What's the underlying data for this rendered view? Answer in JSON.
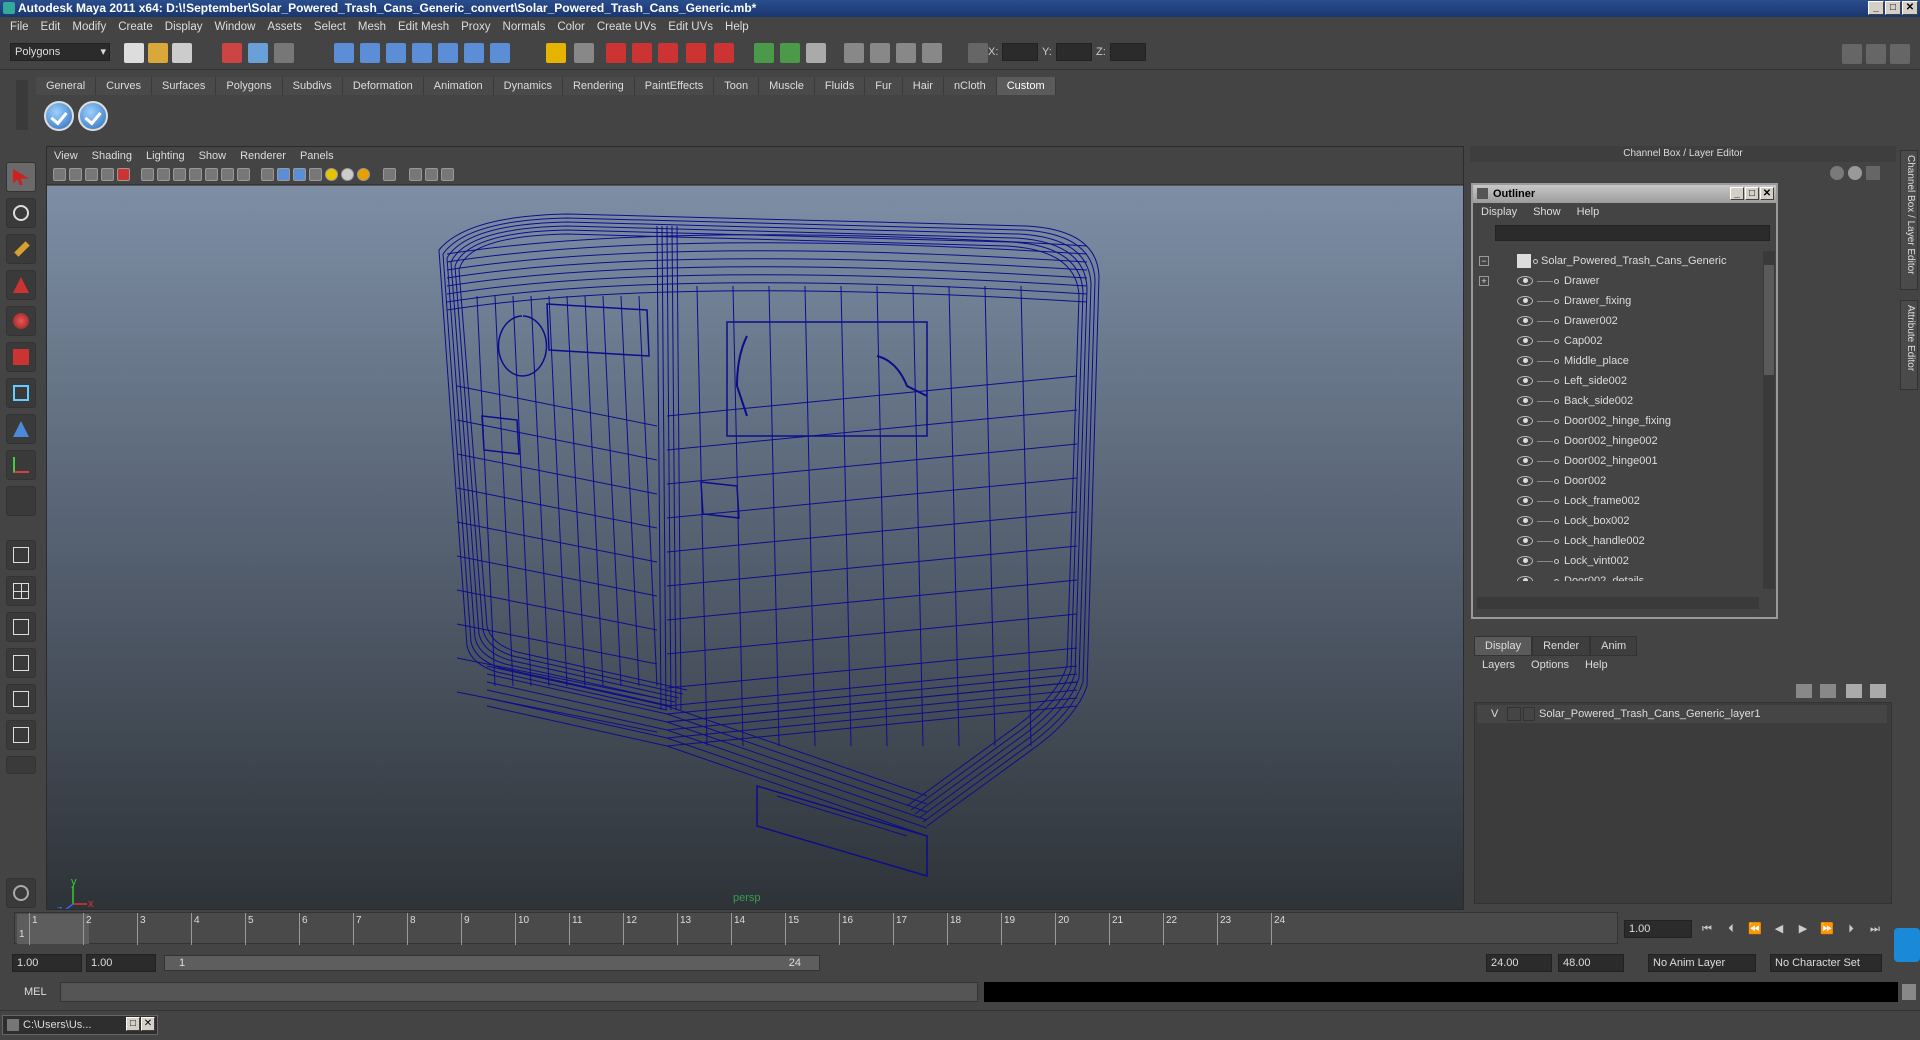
{
  "title": "Autodesk Maya 2011 x64: D:\\!September\\Solar_Powered_Trash_Cans_Generic_convert\\Solar_Powered_Trash_Cans_Generic.mb*",
  "window_buttons": [
    "_",
    "□",
    "✕"
  ],
  "menubar": [
    "File",
    "Edit",
    "Modify",
    "Create",
    "Display",
    "Window",
    "Assets",
    "Select",
    "Mesh",
    "Edit Mesh",
    "Proxy",
    "Normals",
    "Color",
    "Create UVs",
    "Edit UVs",
    "Help"
  ],
  "status": {
    "mode": "Polygons",
    "x_label": "X:",
    "y_label": "Y:",
    "z_label": "Z:"
  },
  "shelf_tabs": [
    "General",
    "Curves",
    "Surfaces",
    "Polygons",
    "Subdivs",
    "Deformation",
    "Animation",
    "Dynamics",
    "Rendering",
    "PaintEffects",
    "Toon",
    "Muscle",
    "Fluids",
    "Fur",
    "Hair",
    "nCloth",
    "Custom"
  ],
  "shelf_active": "Custom",
  "viewport": {
    "menu": [
      "View",
      "Shading",
      "Lighting",
      "Show",
      "Renderer",
      "Panels"
    ],
    "camera": "persp",
    "axis_x": "x",
    "axis_y": "y",
    "axis_z": "z",
    "wire_color": "#0d0d8c"
  },
  "dock_title": "Channel Box / Layer Editor",
  "side_tabs": [
    "Channel Box / Layer Editor",
    "Attribute Editor"
  ],
  "outliner": {
    "title": "Outliner",
    "menu": [
      "Display",
      "Show",
      "Help"
    ],
    "items": [
      "Solar_Powered_Trash_Cans_Generic",
      "Drawer",
      "Drawer_fixing",
      "Drawer002",
      "Cap002",
      "Middle_place",
      "Left_side002",
      "Back_side002",
      "Door002_hinge_fixing",
      "Door002_hinge002",
      "Door002_hinge001",
      "Door002",
      "Lock_frame002",
      "Lock_box002",
      "Lock_handle002",
      "Lock_vint002",
      "Door002_details"
    ]
  },
  "layer_editor": {
    "tabs": [
      "Display",
      "Render",
      "Anim"
    ],
    "active_tab": "Display",
    "menu": [
      "Layers",
      "Options",
      "Help"
    ],
    "layer_visible": "V",
    "layer_name": "Solar_Powered_Trash_Cans_Generic_layer1"
  },
  "timeline": {
    "ticks": [
      "1",
      "2",
      "3",
      "4",
      "5",
      "6",
      "7",
      "8",
      "9",
      "10",
      "11",
      "12",
      "13",
      "14",
      "15",
      "16",
      "17",
      "18",
      "19",
      "20",
      "21",
      "22",
      "23",
      "24"
    ],
    "current_frame_marker": "1",
    "current_frame": "1.00"
  },
  "range": {
    "start": "1.00",
    "playback_start": "1.00",
    "slider_start": "1",
    "slider_end": "24",
    "playback_end": "24.00",
    "end": "48.00",
    "anim_layer": "No Anim Layer",
    "character_set": "No Character Set"
  },
  "command_line": {
    "label": "MEL"
  },
  "taskbar": {
    "item": "C:\\Users\\Us..."
  }
}
